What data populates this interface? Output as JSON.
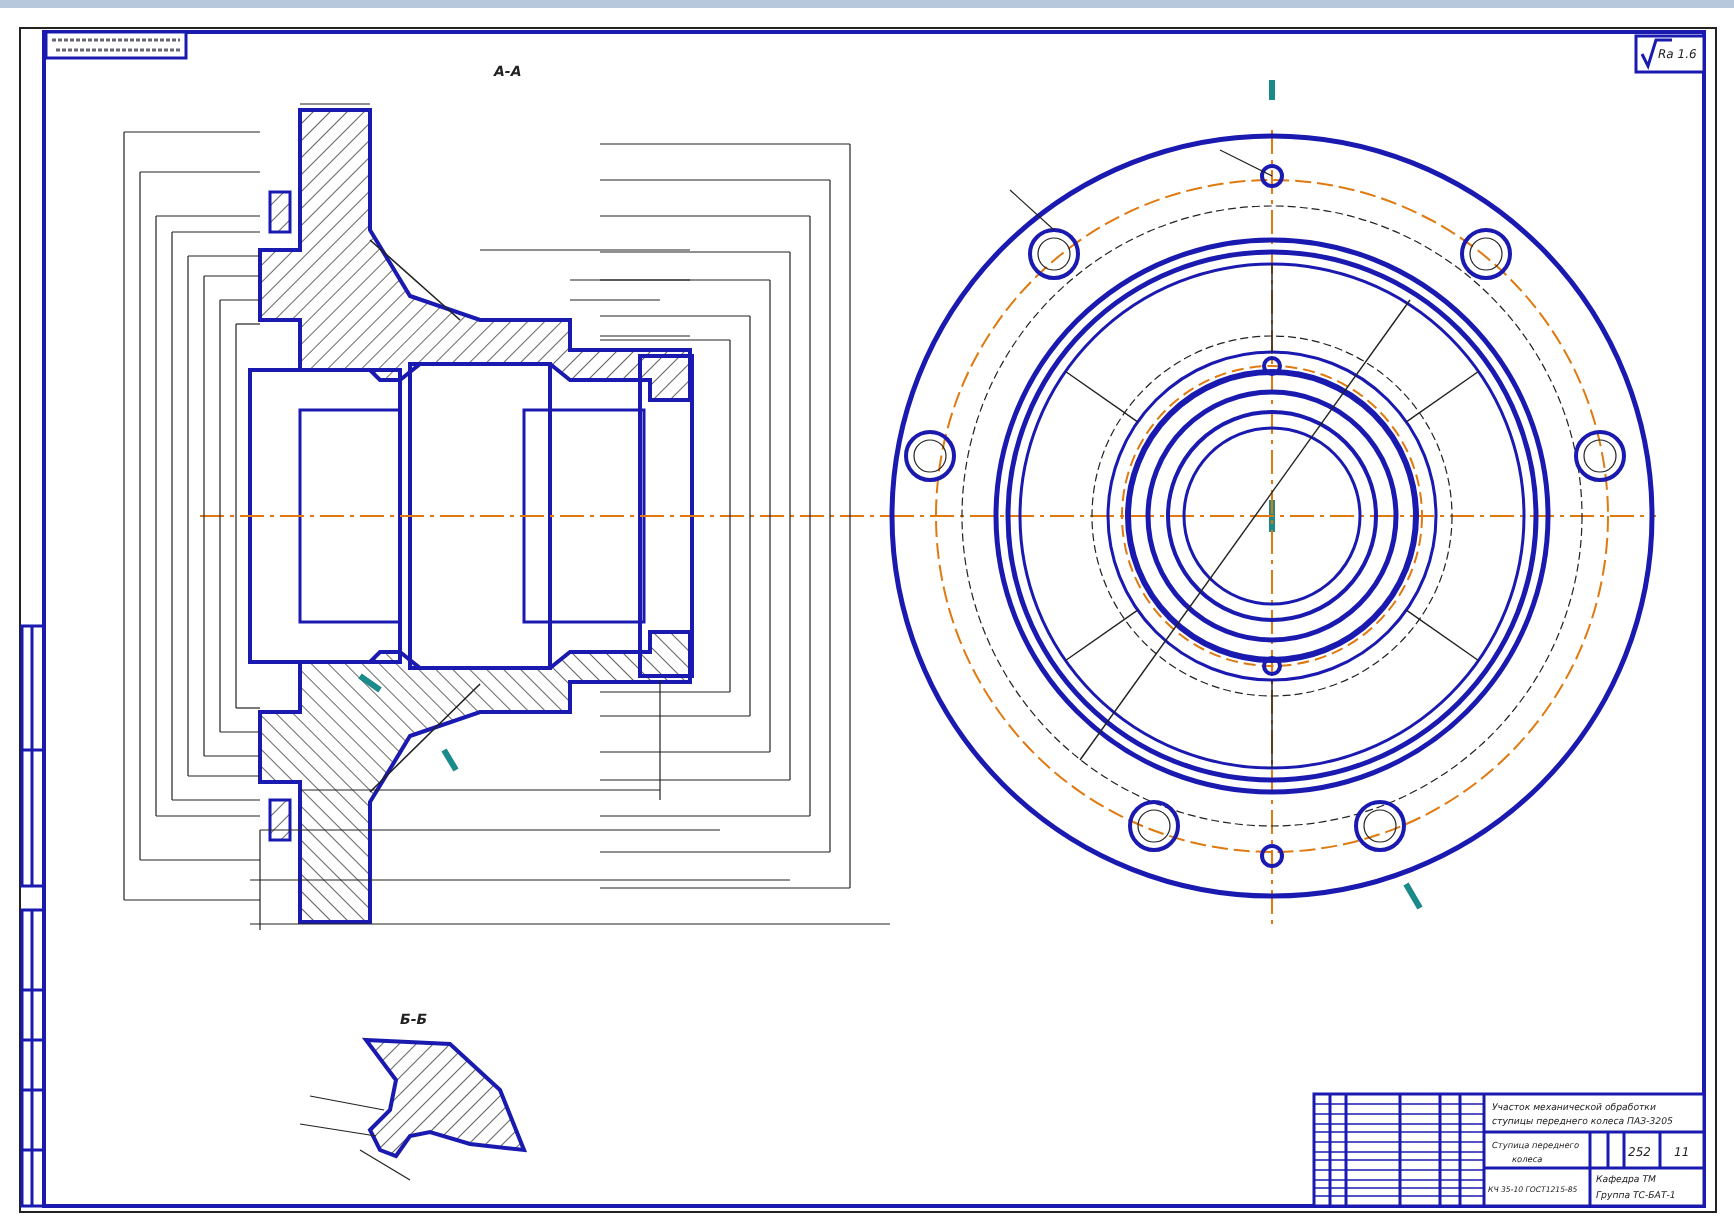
{
  "sheet": {
    "roughness": "Ra 1.6",
    "sections": [
      {
        "kind": "main",
        "label": "А-А"
      },
      {
        "kind": "detail",
        "label": "Б-Б"
      }
    ],
    "title_block": {
      "title": "Участок механической обработки ступицы переднего колеса ПАЗ-3205",
      "part_name": "Ступица переднего колеса",
      "material": "КЧ 35-10 ГОСТ1215-85",
      "mass": "252",
      "scale": "11",
      "department": "Кафедра ТМ",
      "group": "Группа ТС-БАТ-1"
    }
  }
}
